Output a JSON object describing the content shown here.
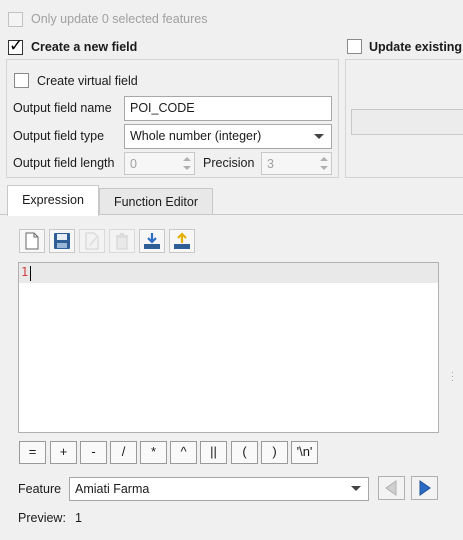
{
  "only_update": {
    "label": "Only update 0 selected features",
    "checked": false,
    "enabled": false
  },
  "create_field": {
    "label": "Create a new field",
    "checked": true,
    "virtual": {
      "label": "Create virtual field",
      "checked": false
    },
    "name": {
      "label": "Output field name",
      "value": "POI_CODE"
    },
    "type": {
      "label": "Output field type",
      "value": "Whole number (integer)"
    },
    "length": {
      "label": "Output field length",
      "value": "0"
    },
    "precision": {
      "label": "Precision",
      "value": "3"
    }
  },
  "update_existing": {
    "label": "Update existing",
    "checked": false
  },
  "tabs": [
    {
      "label": "Expression",
      "active": true
    },
    {
      "label": "Function Editor",
      "active": false
    }
  ],
  "toolbar_icons": [
    "new-file-icon",
    "save-icon",
    "edit-icon",
    "delete-icon",
    "import-icon",
    "export-icon"
  ],
  "editor": {
    "line_number": "1",
    "text": ""
  },
  "operators": [
    "=",
    "+",
    "-",
    "/",
    "*",
    "^",
    "||",
    "(",
    ")",
    "'\\n'"
  ],
  "feature": {
    "label": "Feature",
    "value": "Amiati Farma"
  },
  "preview": {
    "label": "Preview:",
    "value": "1"
  },
  "colors": {
    "accent": "#2b6cc4",
    "line_number": "#d04040"
  }
}
